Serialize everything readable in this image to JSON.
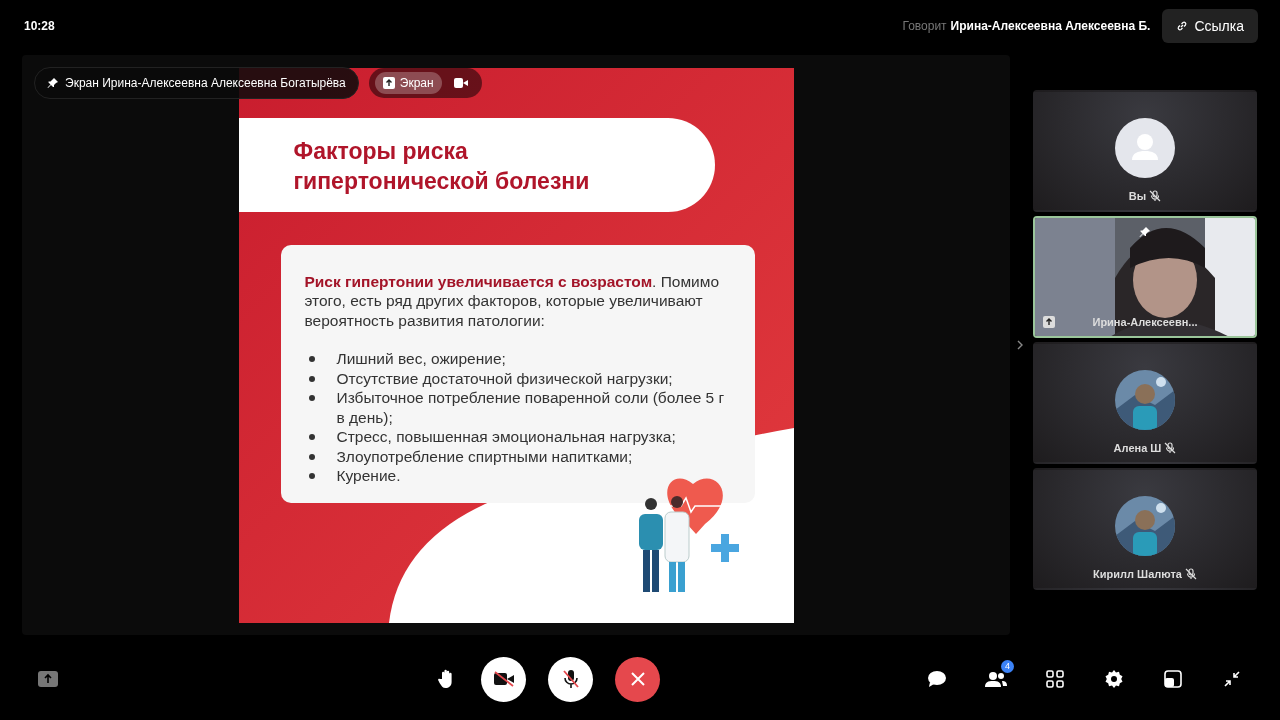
{
  "top_bar": {
    "time": "10:28",
    "speaker_label": "Говорит",
    "speaker_name": "Ирина-Алексеевна Алексеевна Б.",
    "link_button": "Ссылка"
  },
  "stage": {
    "owner_chip": "Экран Ирина-Алексеевна Алексеевна Богатырёва",
    "source_tabs": [
      {
        "kind": "screen",
        "label": "Экран",
        "selected": true
      },
      {
        "kind": "camera",
        "selected": false
      }
    ],
    "slide": {
      "title_lines": [
        "Факторы риска",
        "гипертонической болезни"
      ],
      "intro": "**Риск гипертонии увеличивается с возрастом**. Помимо этого, есть ряд других факторов, которые увеличивают вероятность развития патологии:",
      "bullets": [
        "Лишний вес, ожирение;",
        "Отсутствие достаточной физической нагрузки;",
        "Избыточное потребление поваренной соли (более 5 г в день);",
        "Стресс, повышенная эмоциональная нагрузка;",
        "Злоупотребление спиртными напитками;",
        "Курение."
      ]
    }
  },
  "participants": [
    {
      "name": "Вы",
      "kind": "avatar",
      "muted": true,
      "pinned": false,
      "sharing": false,
      "selected": false
    },
    {
      "name": "Ирина-Алексеевн...",
      "kind": "video",
      "muted": false,
      "pinned": true,
      "sharing": true,
      "selected": true
    },
    {
      "name": "Алена Ш",
      "muted": true,
      "pinned": false,
      "sharing": false,
      "selected": false
    },
    {
      "name": "Кирилл Шалюта",
      "muted": true,
      "pinned": false,
      "sharing": false,
      "selected": false
    }
  ],
  "controls": {
    "participants_count": "4"
  }
}
